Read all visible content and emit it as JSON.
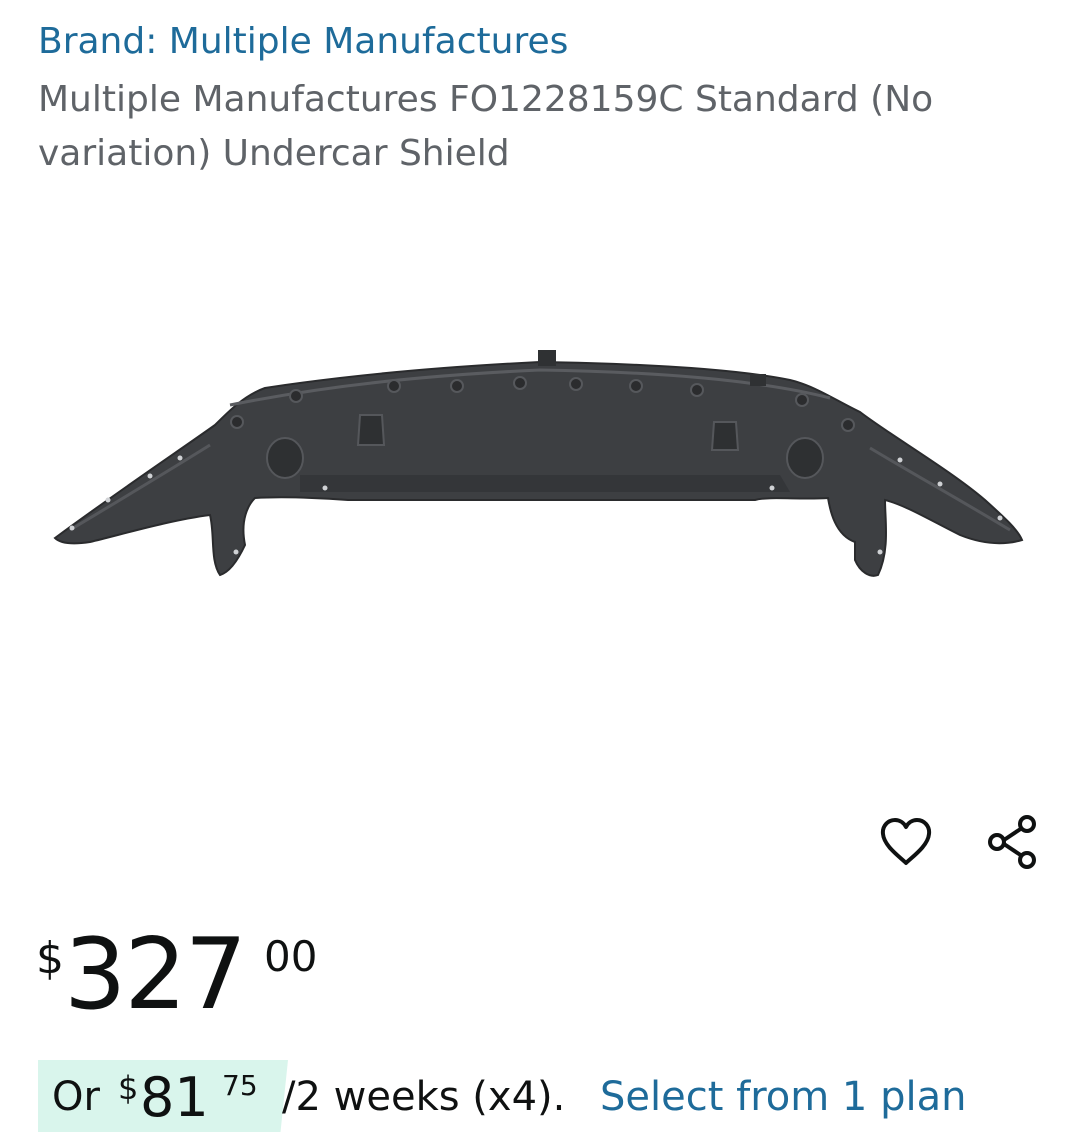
{
  "brand": {
    "label": "Brand: Multiple Manufactures"
  },
  "product": {
    "title": "Multiple Manufactures FO1228159C Standard (No variation) Undercar Shield"
  },
  "actions": {
    "wishlist_icon": "heart-outline-icon",
    "share_icon": "share-icon"
  },
  "price": {
    "symbol": "$",
    "whole": "327",
    "fraction": "00"
  },
  "installment": {
    "prefix": "Or",
    "symbol": "$",
    "whole": "81",
    "fraction": "75",
    "period": "/2 weeks (x4).",
    "link": "Select from 1 plan"
  },
  "colors": {
    "link": "#1e6b9a",
    "title_text": "#5f6368",
    "price_text": "#0f1111",
    "installment_badge": "#d9f5ec",
    "product_part": "#3d3f42"
  }
}
